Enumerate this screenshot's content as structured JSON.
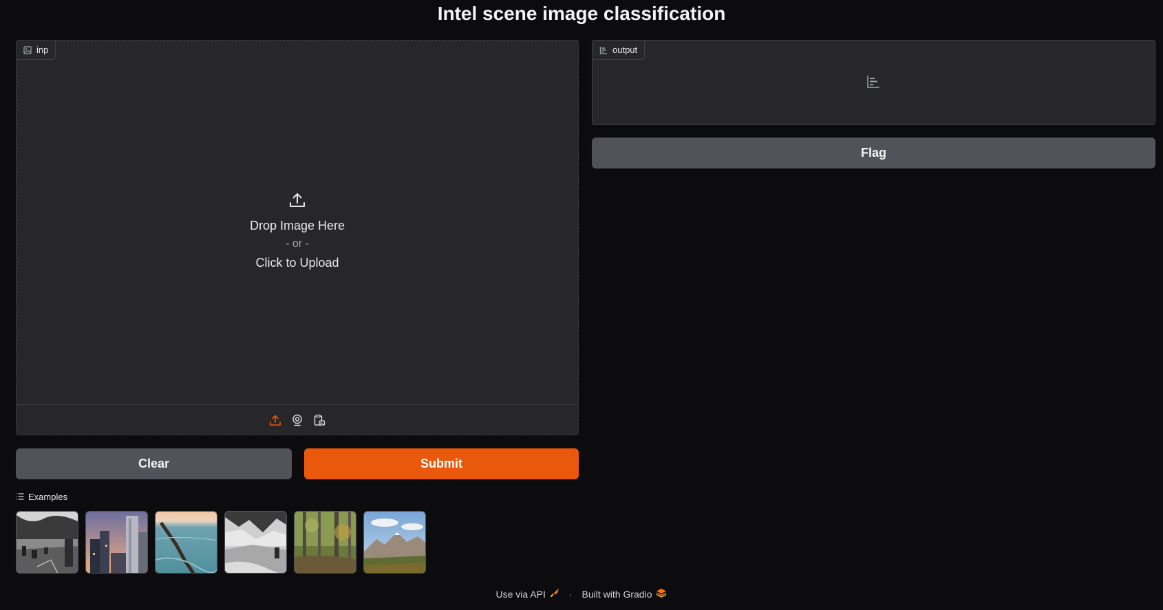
{
  "page": {
    "title": "Intel scene image classification"
  },
  "input_panel": {
    "label": "inp",
    "drop_text": "Drop Image Here",
    "or_text": "- or -",
    "click_text": "Click to Upload",
    "sources": [
      "upload-icon",
      "webcam-icon",
      "clipboard-icon"
    ],
    "active_source_color": "#ea580c"
  },
  "output_panel": {
    "label": "output",
    "empty_icon": "bar-chart-icon"
  },
  "buttons": {
    "clear": "Clear",
    "submit": "Submit",
    "flag": "Flag"
  },
  "colors": {
    "primary": "#ea580c",
    "secondary": "#52525b",
    "panel": "#27272a",
    "background": "#0c0c0f"
  },
  "examples": {
    "label": "Examples",
    "items": [
      "street",
      "buildings",
      "sea",
      "glacier",
      "forest",
      "mountain"
    ]
  },
  "footer": {
    "api_text": "Use via API",
    "separator": "·",
    "built_text": "Built with Gradio"
  }
}
